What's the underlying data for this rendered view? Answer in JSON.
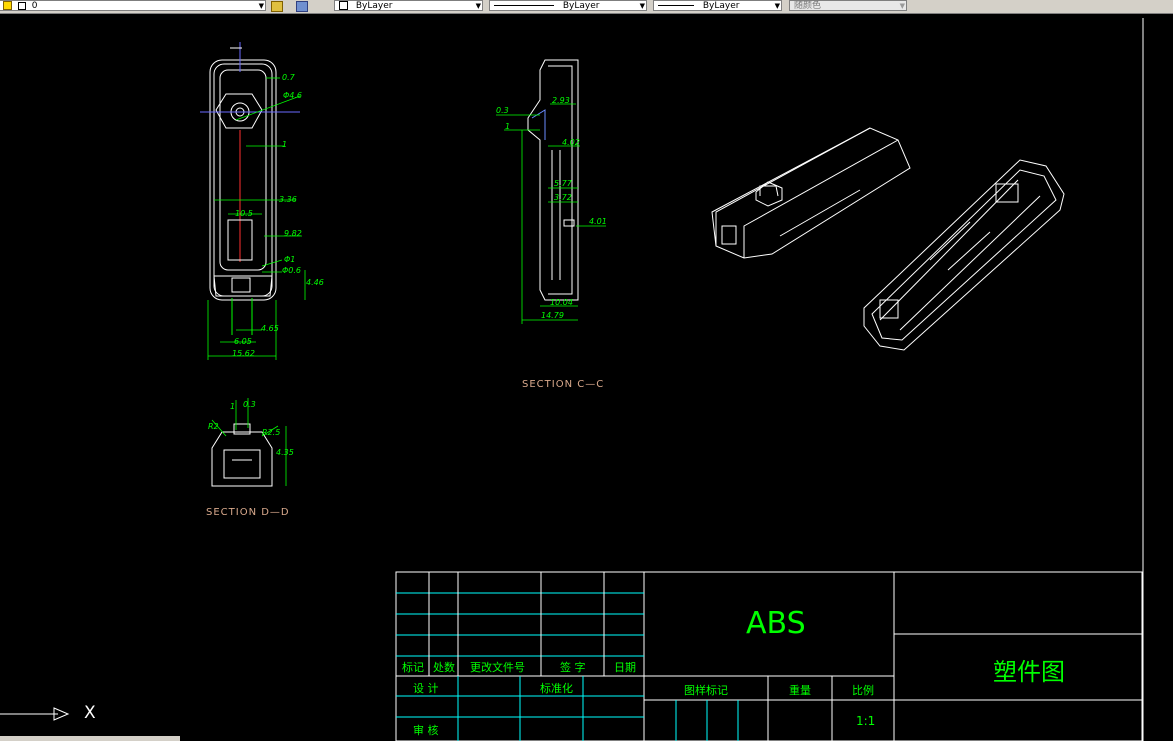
{
  "toolbar": {
    "layer_value": "0",
    "color_value": "ByLayer",
    "linetype_value": "ByLayer",
    "lineweight_value": "ByLayer",
    "plotstyle_value": "随颜色"
  },
  "drawing": {
    "section_cc": "SECTION C—C",
    "section_dd": "SECTION D—D",
    "ucs_x": "X",
    "dimensions": {
      "d1": "0.7",
      "d2": "Φ4.6",
      "d3": "1",
      "d4": "3.36",
      "d5": "10.5",
      "d6": "9.82",
      "d7": "Φ1",
      "d8": "Φ0.6",
      "d9": "4.46",
      "d10": "4.65",
      "d11": "6.05",
      "d12": "15.62",
      "c1": "0.3",
      "c2": "1",
      "c3": "2.93",
      "c4": "4.02",
      "c5": "5.77",
      "c6": "3.72",
      "c7": "4.01",
      "c8": "10.04",
      "c9": "14.79",
      "e1": "1",
      "e2": "0.3",
      "e3": "R2",
      "e4": "R2.5",
      "e5": "4.35"
    }
  },
  "title_block": {
    "material": "ABS",
    "drawing_name": "塑件图",
    "header_mark": "标记",
    "header_count": "处数",
    "header_docno": "更改文件号",
    "header_sign": "签  字",
    "header_date": "日期",
    "design": "设  计",
    "standardize": "标准化",
    "review": "审  核",
    "figure_mark": "图样标记",
    "weight": "重量",
    "scale_label": "比例",
    "scale_value": "1:1"
  },
  "colors": {
    "background": "#000000",
    "border": "#ffffff",
    "grid": "#00ffff",
    "dimension": "#00ff00",
    "label": "#d9a98c"
  }
}
